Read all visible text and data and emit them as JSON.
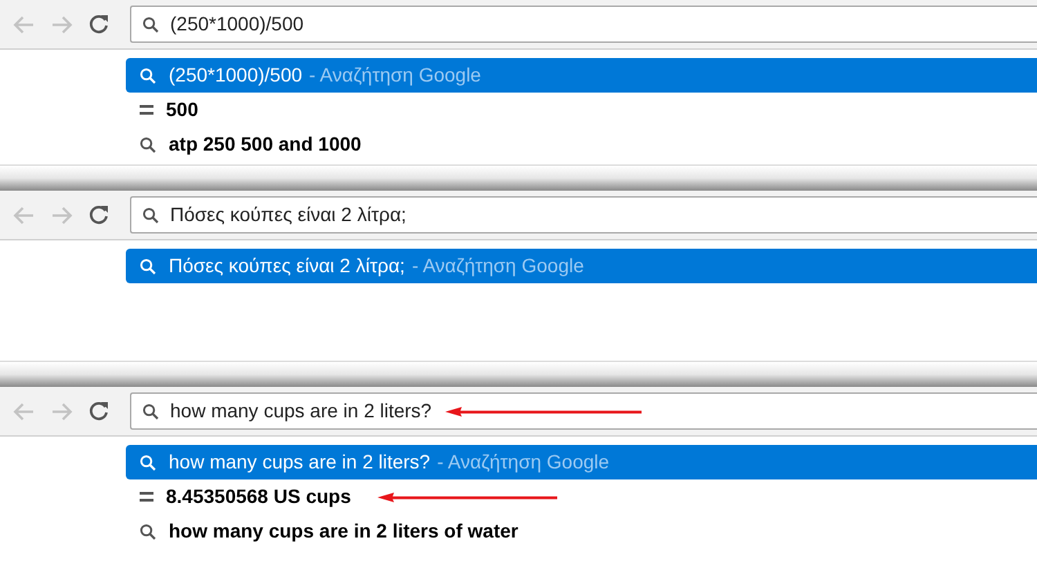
{
  "panels": [
    {
      "address": {
        "value": "(250*1000)/500",
        "arrow": false
      },
      "suggestions": [
        {
          "kind": "search",
          "text": "(250*1000)/500",
          "suffix": "- Αναζήτηση Google",
          "selected": true,
          "arrow": false
        },
        {
          "kind": "answer",
          "text": "500",
          "selected": false,
          "arrow": false
        },
        {
          "kind": "search",
          "text": "atp 250 500 and 1000",
          "selected": false,
          "arrow": false
        }
      ]
    },
    {
      "address": {
        "value": "Πόσες κούπες είναι 2 λίτρα;",
        "arrow": false
      },
      "suggestions": [
        {
          "kind": "search",
          "text": "Πόσες κούπες είναι 2 λίτρα;",
          "suffix": "- Αναζήτηση Google",
          "selected": true,
          "arrow": false
        }
      ]
    },
    {
      "address": {
        "value": "how many cups are in 2 liters?",
        "arrow": true
      },
      "suggestions": [
        {
          "kind": "search",
          "text": "how many cups are in 2 liters?",
          "suffix": "- Αναζήτηση Google",
          "selected": true,
          "arrow": false
        },
        {
          "kind": "answer",
          "text": "8.45350568 US cups",
          "selected": false,
          "arrow": true
        },
        {
          "kind": "search",
          "text": "how many cups are in 2 liters of water",
          "selected": false,
          "arrow": false
        }
      ]
    }
  ]
}
